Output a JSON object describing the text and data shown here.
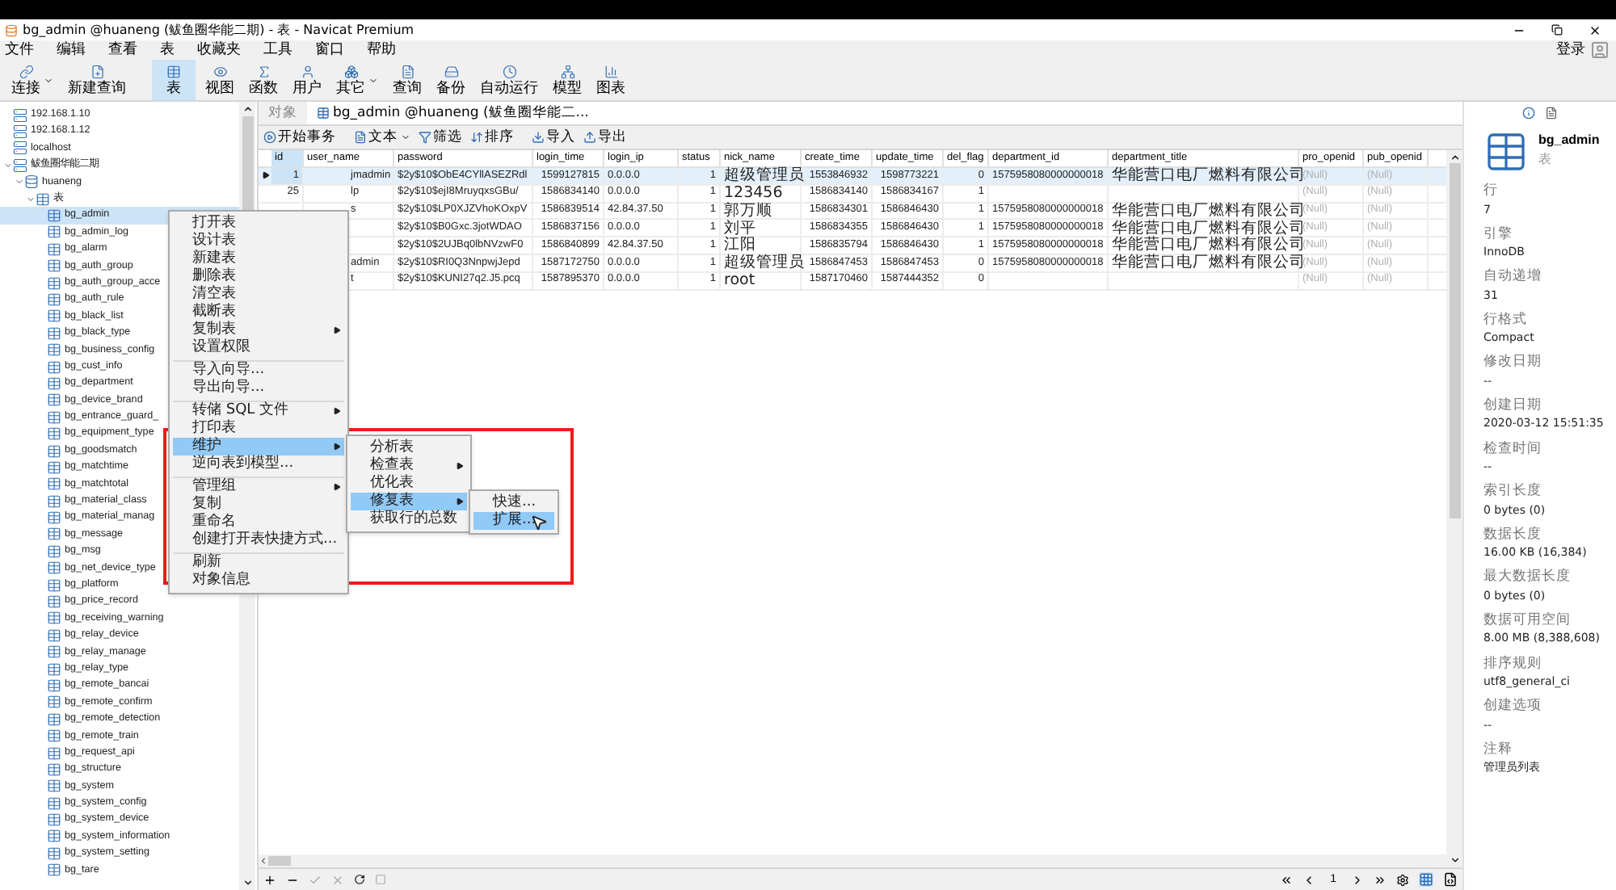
{
  "window": {
    "title": "bg_admin @huaneng (鲅鱼圈华能二期) - 表 - Navicat Premium"
  },
  "menu_bar": [
    "文件",
    "编辑",
    "查看",
    "表",
    "收藏夹",
    "工具",
    "窗口",
    "帮助"
  ],
  "login": "登录",
  "toolbar": [
    {
      "label": "连接",
      "selected": false,
      "has_dropdown": true
    },
    {
      "label": "新建查询",
      "selected": false,
      "has_dropdown": false
    },
    {
      "label": "表",
      "selected": true,
      "has_dropdown": false
    },
    {
      "label": "视图",
      "selected": false,
      "has_dropdown": false
    },
    {
      "label": "函数",
      "selected": false,
      "has_dropdown": false
    },
    {
      "label": "用户",
      "selected": false,
      "has_dropdown": false
    },
    {
      "label": "其它",
      "selected": false,
      "has_dropdown": true
    },
    {
      "label": "查询",
      "selected": false,
      "has_dropdown": false
    },
    {
      "label": "备份",
      "selected": false,
      "has_dropdown": false
    },
    {
      "label": "自动运行",
      "selected": false,
      "has_dropdown": false
    },
    {
      "label": "模型",
      "selected": false,
      "has_dropdown": false
    },
    {
      "label": "图表",
      "selected": false,
      "has_dropdown": false
    }
  ],
  "tree": [
    {
      "label": "192.168.1.10",
      "kind": "connection",
      "selected": false
    },
    {
      "label": "192.168.1.12",
      "kind": "connection",
      "selected": false
    },
    {
      "label": "localhost",
      "kind": "connection",
      "selected": false
    },
    {
      "label": "鲅鱼圈华能二期",
      "kind": "connection",
      "selected": false,
      "expanded": true,
      "children": [
        {
          "label": "huaneng",
          "kind": "database",
          "selected": false,
          "expanded": true,
          "children": [
            {
              "label": "表",
              "kind": "folder",
              "selected": false,
              "expanded": true,
              "children": [
                {
                  "label": "bg_admin",
                  "kind": "table",
                  "selected": true
                },
                {
                  "label": "bg_admin_log",
                  "kind": "table",
                  "selected": false
                },
                {
                  "label": "bg_alarm",
                  "kind": "table",
                  "selected": false
                },
                {
                  "label": "bg_auth_group",
                  "kind": "table",
                  "selected": false
                },
                {
                  "label": "bg_auth_group_acce",
                  "kind": "table",
                  "selected": false
                },
                {
                  "label": "bg_auth_rule",
                  "kind": "table",
                  "selected": false
                },
                {
                  "label": "bg_black_list",
                  "kind": "table",
                  "selected": false
                },
                {
                  "label": "bg_black_type",
                  "kind": "table",
                  "selected": false
                },
                {
                  "label": "bg_business_config",
                  "kind": "table",
                  "selected": false
                },
                {
                  "label": "bg_cust_info",
                  "kind": "table",
                  "selected": false
                },
                {
                  "label": "bg_department",
                  "kind": "table",
                  "selected": false
                },
                {
                  "label": "bg_device_brand",
                  "kind": "table",
                  "selected": false
                },
                {
                  "label": "bg_entrance_guard_",
                  "kind": "table",
                  "selected": false
                },
                {
                  "label": "bg_equipment_type",
                  "kind": "table",
                  "selected": false
                },
                {
                  "label": "bg_goodsmatch",
                  "kind": "table",
                  "selected": false
                },
                {
                  "label": "bg_matchtime",
                  "kind": "table",
                  "selected": false
                },
                {
                  "label": "bg_matchtotal",
                  "kind": "table",
                  "selected": false
                },
                {
                  "label": "bg_material_class",
                  "kind": "table",
                  "selected": false
                },
                {
                  "label": "bg_material_manag",
                  "kind": "table",
                  "selected": false
                },
                {
                  "label": "bg_message",
                  "kind": "table",
                  "selected": false
                },
                {
                  "label": "bg_msg",
                  "kind": "table",
                  "selected": false
                },
                {
                  "label": "bg_net_device_type",
                  "kind": "table",
                  "selected": false
                },
                {
                  "label": "bg_platform",
                  "kind": "table",
                  "selected": false
                },
                {
                  "label": "bg_price_record",
                  "kind": "table",
                  "selected": false
                },
                {
                  "label": "bg_receiving_warning",
                  "kind": "table",
                  "selected": false
                },
                {
                  "label": "bg_relay_device",
                  "kind": "table",
                  "selected": false
                },
                {
                  "label": "bg_relay_manage",
                  "kind": "table",
                  "selected": false
                },
                {
                  "label": "bg_relay_type",
                  "kind": "table",
                  "selected": false
                },
                {
                  "label": "bg_remote_bancai",
                  "kind": "table",
                  "selected": false
                },
                {
                  "label": "bg_remote_confirm",
                  "kind": "table",
                  "selected": false
                },
                {
                  "label": "bg_remote_detection",
                  "kind": "table",
                  "selected": false
                },
                {
                  "label": "bg_remote_train",
                  "kind": "table",
                  "selected": false
                },
                {
                  "label": "bg_request_api",
                  "kind": "table",
                  "selected": false
                },
                {
                  "label": "bg_structure",
                  "kind": "table",
                  "selected": false
                },
                {
                  "label": "bg_system",
                  "kind": "table",
                  "selected": false
                },
                {
                  "label": "bg_system_config",
                  "kind": "table",
                  "selected": false
                },
                {
                  "label": "bg_system_device",
                  "kind": "table",
                  "selected": false
                },
                {
                  "label": "bg_system_information",
                  "kind": "table",
                  "selected": false
                },
                {
                  "label": "bg_system_setting",
                  "kind": "table",
                  "selected": false
                },
                {
                  "label": "bg_tare",
                  "kind": "table",
                  "selected": false
                }
              ]
            }
          ]
        }
      ]
    }
  ],
  "tabs": [
    {
      "label": "对象",
      "selected": false
    },
    {
      "label": "bg_admin @huaneng (鲅鱼圈华能二...",
      "selected": true
    }
  ],
  "table_toolbar": [
    {
      "label": "开始事务",
      "has_dropdown": false
    },
    {
      "label": "文本",
      "has_dropdown": true
    },
    {
      "label": "筛选",
      "has_dropdown": false
    },
    {
      "label": "排序",
      "has_dropdown": false
    },
    {
      "label": "导入",
      "has_dropdown": false
    },
    {
      "label": "导出",
      "has_dropdown": false
    }
  ],
  "table": {
    "columns": [
      "id",
      "user_name",
      "password",
      "login_time",
      "login_ip",
      "status",
      "nick_name",
      "create_time",
      "update_time",
      "del_flag",
      "department_id",
      "department_title",
      "pro_openid",
      "pub_openid"
    ],
    "rows": [
      {
        "current": true,
        "id": "1",
        "user_name": "jmadmin",
        "password": "$2y$10$ObE4CYllASEZRdl",
        "login_time": "1599127815",
        "login_ip": "0.0.0.0",
        "status": "1",
        "nick_name": "超级管理员",
        "create_time": "1553846932",
        "update_time": "1598773221",
        "del_flag": "0",
        "department_id": "1575958080000000018",
        "department_title": "华能营口电厂燃料有限公司",
        "pro_openid": "(Null)",
        "pub_openid": "(Null)"
      },
      {
        "current": false,
        "id": "25",
        "user_name": "lp",
        "password": "$2y$10$ejI8MruyqxsGBu/",
        "login_time": "1586834140",
        "login_ip": "0.0.0.0",
        "status": "1",
        "nick_name": "123456",
        "create_time": "1586834140",
        "update_time": "1586834167",
        "del_flag": "1",
        "pro_openid": "(Null)",
        "pub_openid": "(Null)"
      },
      {
        "current": false,
        "user_name": "s",
        "password": "$2y$10$LP0XJZVhoKOxpV",
        "login_time": "1586839514",
        "login_ip": "42.84.37.50",
        "status": "1",
        "nick_name": "郭万顺",
        "create_time": "1586834301",
        "update_time": "1586846430",
        "del_flag": "1",
        "department_id": "1575958080000000018",
        "department_title": "华能营口电厂燃料有限公司",
        "pro_openid": "(Null)",
        "pub_openid": "(Null)"
      },
      {
        "current": false,
        "password": "$2y$10$B0Gxc.3jotWDAO",
        "login_time": "1586837156",
        "login_ip": "0.0.0.0",
        "status": "1",
        "nick_name": "刘平",
        "create_time": "1586834355",
        "update_time": "1586846430",
        "del_flag": "1",
        "department_id": "1575958080000000018",
        "department_title": "华能营口电厂燃料有限公司",
        "pro_openid": "(Null)",
        "pub_openid": "(Null)"
      },
      {
        "current": false,
        "password": "$2y$10$2UJBq0lbNVzwF0",
        "login_time": "1586840899",
        "login_ip": "42.84.37.50",
        "status": "1",
        "nick_name": "江阳",
        "create_time": "1586835794",
        "update_time": "1586846430",
        "del_flag": "1",
        "department_id": "1575958080000000018",
        "department_title": "华能营口电厂燃料有限公司",
        "pro_openid": "(Null)",
        "pub_openid": "(Null)"
      },
      {
        "current": false,
        "user_name": "admin",
        "password": "$2y$10$RI0Q3NnpwjJepd",
        "login_time": "1587172750",
        "login_ip": "0.0.0.0",
        "status": "1",
        "nick_name": "超级管理员",
        "create_time": "1586847453",
        "update_time": "1586847453",
        "del_flag": "0",
        "department_id": "1575958080000000018",
        "department_title": "华能营口电厂燃料有限公司",
        "pro_openid": "(Null)",
        "pub_openid": "(Null)"
      },
      {
        "current": false,
        "user_name": "t",
        "password": "$2y$10$KUNI27q2.J5.pcq",
        "login_time": "1587895370",
        "login_ip": "0.0.0.0",
        "status": "1",
        "nick_name": "root",
        "create_time": "1587170460",
        "update_time": "1587444352",
        "del_flag": "0",
        "pro_openid": "(Null)",
        "pub_openid": "(Null)"
      }
    ]
  },
  "pager": {
    "page": "1"
  },
  "context_menu": {
    "items": [
      {
        "label": "打开表",
        "selected": false,
        "has_submenu": false,
        "separator_before": false
      },
      {
        "label": "设计表",
        "selected": false,
        "has_submenu": false,
        "separator_before": false
      },
      {
        "label": "新建表",
        "selected": false,
        "has_submenu": false,
        "separator_before": false
      },
      {
        "label": "删除表",
        "selected": false,
        "has_submenu": false,
        "separator_before": false
      },
      {
        "label": "清空表",
        "selected": false,
        "has_submenu": false,
        "separator_before": false
      },
      {
        "label": "截断表",
        "selected": false,
        "has_submenu": false,
        "separator_before": false
      },
      {
        "label": "复制表",
        "selected": false,
        "has_submenu": true,
        "separator_before": false
      },
      {
        "label": "设置权限",
        "selected": false,
        "has_submenu": false,
        "separator_before": false
      },
      {
        "label": "导入向导...",
        "selected": false,
        "has_submenu": false,
        "separator_before": true
      },
      {
        "label": "导出向导...",
        "selected": false,
        "has_submenu": false,
        "separator_before": false
      },
      {
        "label": "转储 SQL 文件",
        "selected": false,
        "has_submenu": true,
        "separator_before": true
      },
      {
        "label": "打印表",
        "selected": false,
        "has_submenu": false,
        "separator_before": false
      },
      {
        "label": "维护",
        "selected": true,
        "has_submenu": true,
        "separator_before": false
      },
      {
        "label": "逆向表到模型...",
        "selected": false,
        "has_submenu": false,
        "separator_before": false
      },
      {
        "label": "管理组",
        "selected": false,
        "has_submenu": true,
        "separator_before": true
      },
      {
        "label": "复制",
        "selected": false,
        "has_submenu": false,
        "separator_before": false
      },
      {
        "label": "重命名",
        "selected": false,
        "has_submenu": false,
        "separator_before": false
      },
      {
        "label": "创建打开表快捷方式...",
        "selected": false,
        "has_submenu": false,
        "separator_before": false
      },
      {
        "label": "刷新",
        "selected": false,
        "has_submenu": false,
        "separator_before": true
      },
      {
        "label": "对象信息",
        "selected": false,
        "has_submenu": false,
        "separator_before": false
      }
    ]
  },
  "submenu": {
    "items": [
      {
        "label": "分析表",
        "selected": false,
        "has_submenu": false
      },
      {
        "label": "检查表",
        "selected": false,
        "has_submenu": true
      },
      {
        "label": "优化表",
        "selected": false,
        "has_submenu": false
      },
      {
        "label": "修复表",
        "selected": true,
        "has_submenu": true
      },
      {
        "label": "获取行的总数",
        "selected": false,
        "has_submenu": false
      }
    ]
  },
  "submenu_2": {
    "items": [
      {
        "label": "快速...",
        "selected": false
      },
      {
        "label": "扩展...",
        "selected": true
      }
    ]
  },
  "info_panel": {
    "name": "bg_admin",
    "type": "表",
    "properties": [
      {
        "label": "行",
        "value": "7"
      },
      {
        "label": "引擎",
        "value": "InnoDB"
      },
      {
        "label": "自动递增",
        "value": "31"
      },
      {
        "label": "行格式",
        "value": "Compact"
      },
      {
        "label": "修改日期",
        "value": "--"
      },
      {
        "label": "创建日期",
        "value": "2020-03-12 15:51:35"
      },
      {
        "label": "检查时间",
        "value": "--"
      },
      {
        "label": "索引长度",
        "value": "0 bytes (0)"
      },
      {
        "label": "数据长度",
        "value": "16.00 KB (16,384)"
      },
      {
        "label": "最大数据长度",
        "value": "0 bytes (0)"
      },
      {
        "label": "数据可用空间",
        "value": "8.00 MB (8,388,608)"
      },
      {
        "label": "排序规则",
        "value": "utf8_general_ci"
      },
      {
        "label": "创建选项",
        "value": "--"
      },
      {
        "label": "注释",
        "value": "管理员列表"
      }
    ]
  }
}
